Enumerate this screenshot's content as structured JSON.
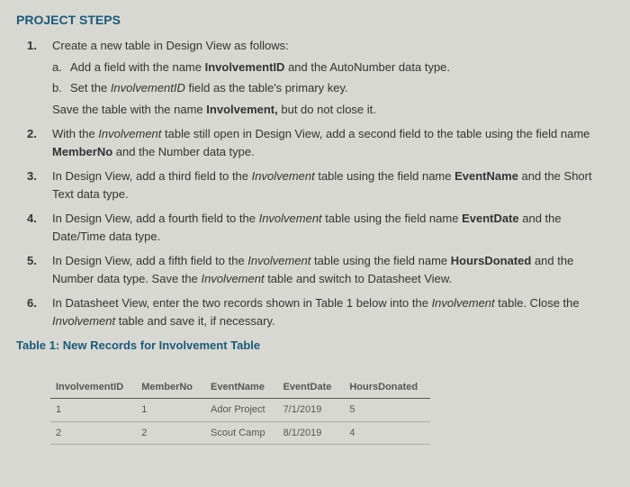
{
  "heading": "PROJECT STEPS",
  "steps": [
    {
      "num": "1.",
      "text": "Create a new table in Design View as follows:",
      "sub": [
        {
          "num": "a.",
          "html": "Add a field with the name <b>InvolvementID</b> and the AutoNumber data type."
        },
        {
          "num": "b.",
          "html": "Set the <span class='em'>InvolvementID</span> field as the table's primary key."
        }
      ],
      "after": "Save the table with the name <b>Involvement,</b> but do not close it."
    },
    {
      "num": "2.",
      "html": "With the <span class='em'>Involvement</span> table still open in Design View, add a second field to the table using the field name <b>MemberNo</b> and the Number data type."
    },
    {
      "num": "3.",
      "html": "In Design View, add a third field to the <span class='em'>Involvement</span> table using the field name <b>EventName</b> and the Short Text data type."
    },
    {
      "num": "4.",
      "html": "In Design View, add a fourth field to the <span class='em'>Involvement</span> table using the field name <b>EventDate</b> and the Date/Time data type."
    },
    {
      "num": "5.",
      "html": "In Design View, add a fifth field to the <span class='em'>Involvement</span> table using the field name <b>HoursDonated</b> and the Number data type. Save the <span class='em'>Involvement</span> table and switch to Datasheet View."
    },
    {
      "num": "6.",
      "html": "In Datasheet View, enter the two records shown in Table 1 below into the <span class='em'>Involvement</span> table. Close the <span class='em'>Involvement</span> table and save it, if necessary."
    }
  ],
  "table_caption": "Table 1: New Records for Involvement Table",
  "table": {
    "headers": [
      "InvolvementID",
      "MemberNo",
      "EventName",
      "EventDate",
      "HoursDonated"
    ],
    "rows": [
      [
        "1",
        "1",
        "Ador Project",
        "7/1/2019",
        "5"
      ],
      [
        "2",
        "2",
        "Scout Camp",
        "8/1/2019",
        "4"
      ]
    ]
  }
}
